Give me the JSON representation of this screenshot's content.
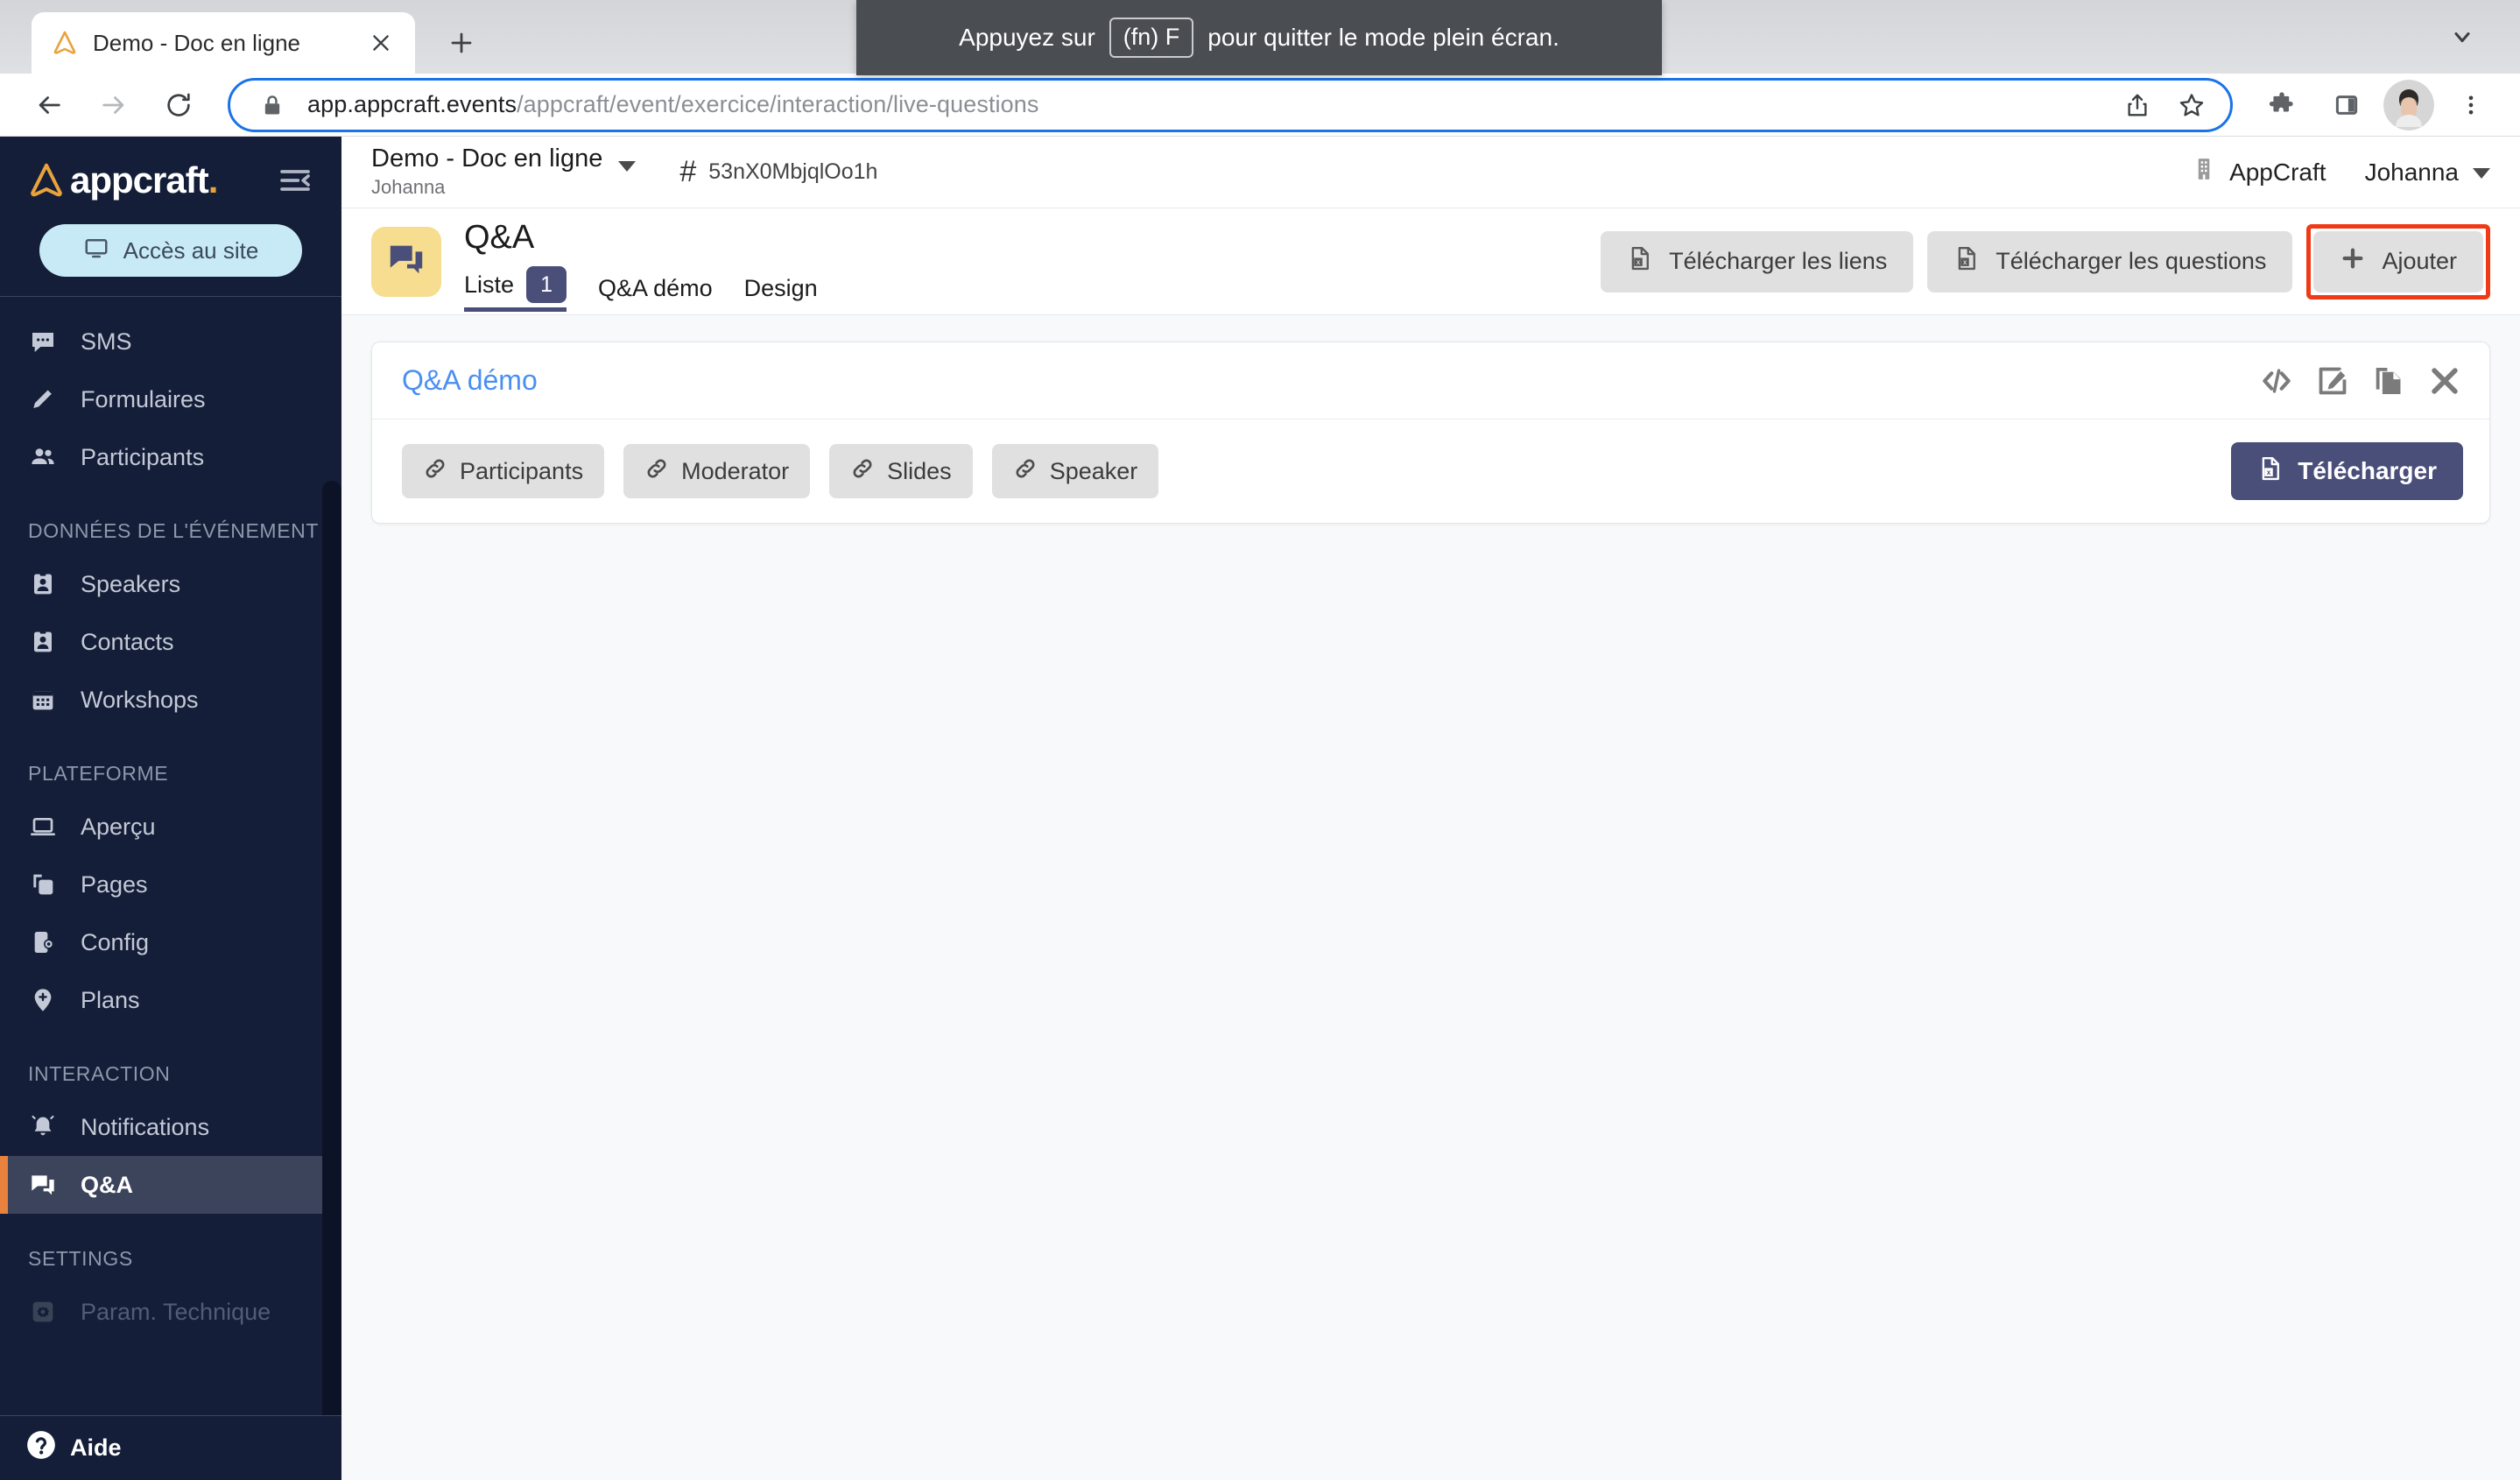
{
  "browser": {
    "tab": {
      "title": "Demo - Doc en ligne",
      "favicon": "appcraft-logo-icon",
      "close_label": "×"
    },
    "new_tab_label": "+",
    "fullscreen_toast": {
      "prefix": "Appuyez sur",
      "key": "(fn) F",
      "suffix": "pour quitter le mode plein écran."
    },
    "omnibox": {
      "host": "app.appcraft.events",
      "path": "/appcraft/event/exercice/interaction/live-questions",
      "lock": "lock-icon"
    },
    "toolbar_icons": [
      "back-icon",
      "forward-icon",
      "reload-icon",
      "share-icon",
      "bookmark-star-icon",
      "extensions-puzzle-icon",
      "side-panel-icon",
      "profile-avatar",
      "chrome-menu-icon"
    ]
  },
  "sidebar": {
    "logo_text": "appcraft",
    "logo_dot": ".",
    "collapse_label": "collapse-menu",
    "access_button": "Accès au site",
    "groups": [
      {
        "title": null,
        "items": [
          {
            "label": "SMS",
            "icon": "sms-icon",
            "state": "normal"
          },
          {
            "label": "Formulaires",
            "icon": "pencil-icon",
            "state": "normal"
          },
          {
            "label": "Participants",
            "icon": "people-icon",
            "state": "normal"
          }
        ]
      },
      {
        "title": "DONNÉES DE L'ÉVÉNEMENT",
        "items": [
          {
            "label": "Speakers",
            "icon": "badge-person-icon",
            "state": "normal"
          },
          {
            "label": "Contacts",
            "icon": "badge-person-icon",
            "state": "normal"
          },
          {
            "label": "Workshops",
            "icon": "calendar-icon",
            "state": "normal"
          }
        ]
      },
      {
        "title": "PLATEFORME",
        "items": [
          {
            "label": "Aperçu",
            "icon": "laptop-icon",
            "state": "normal"
          },
          {
            "label": "Pages",
            "icon": "pages-copy-icon",
            "state": "normal"
          },
          {
            "label": "Config",
            "icon": "phone-gear-icon",
            "state": "normal"
          },
          {
            "label": "Plans",
            "icon": "map-pin-icon",
            "state": "normal"
          }
        ]
      },
      {
        "title": "INTERACTION",
        "items": [
          {
            "label": "Notifications",
            "icon": "bell-icon",
            "state": "normal"
          },
          {
            "label": "Q&A",
            "icon": "chat-bubbles-icon",
            "state": "active"
          }
        ]
      },
      {
        "title": "SETTINGS",
        "items": [
          {
            "label": "Param. Technique",
            "icon": "gear-square-icon",
            "state": "muted"
          }
        ]
      }
    ],
    "help": {
      "label": "Aide",
      "icon": "question-mark-icon"
    }
  },
  "topbar": {
    "event_name": "Demo - Doc en ligne",
    "event_owner": "Johanna",
    "event_code_hash": "#",
    "event_code": "53nX0MbjqlOo1h",
    "org": "AppCraft",
    "org_icon": "building-icon",
    "user": "Johanna"
  },
  "page": {
    "icon": "chat-bubbles-icon",
    "title": "Q&A",
    "tabs": [
      {
        "label": "Liste",
        "badge": "1",
        "active": true
      },
      {
        "label": "Q&A démo",
        "badge": null,
        "active": false
      },
      {
        "label": "Design",
        "badge": null,
        "active": false
      }
    ],
    "actions": [
      {
        "label": "Télécharger les liens",
        "icon": "excel-file-icon",
        "highlighted": false
      },
      {
        "label": "Télécharger les questions",
        "icon": "excel-file-icon",
        "highlighted": false
      },
      {
        "label": "Ajouter",
        "icon": "plus-icon",
        "highlighted": true
      }
    ],
    "highlight_color": "#f03a17"
  },
  "card": {
    "title": "Q&A démo",
    "head_icons": [
      "embed-code-icon",
      "edit-pencil-icon",
      "duplicate-icon",
      "close-x-icon"
    ],
    "links": [
      {
        "label": "Participants",
        "icon": "link-icon"
      },
      {
        "label": "Moderator",
        "icon": "link-icon"
      },
      {
        "label": "Slides",
        "icon": "link-icon"
      },
      {
        "label": "Speaker",
        "icon": "link-icon"
      }
    ],
    "download_button": {
      "label": "Télécharger",
      "icon": "excel-file-icon"
    }
  }
}
